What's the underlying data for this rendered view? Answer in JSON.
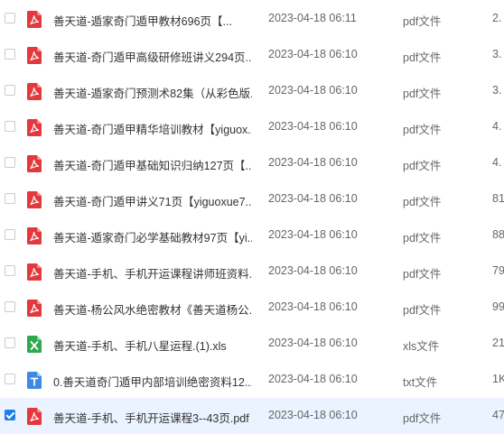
{
  "colors": {
    "pdf_icon": "#e4393c",
    "xls_icon": "#2fa84f",
    "txt_icon": "#3d8ae6",
    "selected_row": "#eaf3ff",
    "checkbox_checked": "#1e7fe8"
  },
  "files": [
    {
      "name": "善天道-遁家奇门遁甲教材696页【...",
      "modified": "2023-04-18 06:11",
      "type": "pdf文件",
      "size": "2.",
      "icon": "pdf-icon",
      "checked": false
    },
    {
      "name": "善天道-奇门遁甲高级研修班讲义294页...",
      "modified": "2023-04-18 06:10",
      "type": "pdf文件",
      "size": "3.",
      "icon": "pdf-icon",
      "checked": false
    },
    {
      "name": "善天道-遁家奇门预测术82集（从彩色版...",
      "modified": "2023-04-18 06:10",
      "type": "pdf文件",
      "size": "3.",
      "icon": "pdf-icon",
      "checked": false
    },
    {
      "name": "善天道-奇门遁甲精华培训教材【yiguox...",
      "modified": "2023-04-18 06:10",
      "type": "pdf文件",
      "size": "4.",
      "icon": "pdf-icon",
      "checked": false
    },
    {
      "name": "善天道-奇门遁甲基础知识归纳127页【...",
      "modified": "2023-04-18 06:10",
      "type": "pdf文件",
      "size": "4.",
      "icon": "pdf-icon",
      "checked": false
    },
    {
      "name": "善天道-奇门遁甲讲义71页【yiguoxue7...",
      "modified": "2023-04-18 06:10",
      "type": "pdf文件",
      "size": "81",
      "icon": "pdf-icon",
      "checked": false
    },
    {
      "name": "善天道-遁家奇门必学基础教材97页【yi...",
      "modified": "2023-04-18 06:10",
      "type": "pdf文件",
      "size": "88",
      "icon": "pdf-icon",
      "checked": false
    },
    {
      "name": "善天道-手机、手机开运课程讲师班资料...",
      "modified": "2023-04-18 06:10",
      "type": "pdf文件",
      "size": "79",
      "icon": "pdf-icon",
      "checked": false
    },
    {
      "name": "善天道-杨公风水绝密教材《善天道杨公...",
      "modified": "2023-04-18 06:10",
      "type": "pdf文件",
      "size": "99",
      "icon": "pdf-icon",
      "checked": false
    },
    {
      "name": "善天道-手机、手机八星运程.(1).xls",
      "modified": "2023-04-18 06:10",
      "type": "xls文件",
      "size": "21",
      "icon": "xls-icon",
      "checked": false
    },
    {
      "name": "0.善天道奇门遁甲内部培训绝密资料12...",
      "modified": "2023-04-18 06:10",
      "type": "txt文件",
      "size": "1K",
      "icon": "txt-icon",
      "checked": false
    },
    {
      "name": "善天道-手机、手机开运课程3--43页.pdf",
      "modified": "2023-04-18 06:10",
      "type": "pdf文件",
      "size": "47",
      "icon": "pdf-icon",
      "checked": true
    }
  ]
}
